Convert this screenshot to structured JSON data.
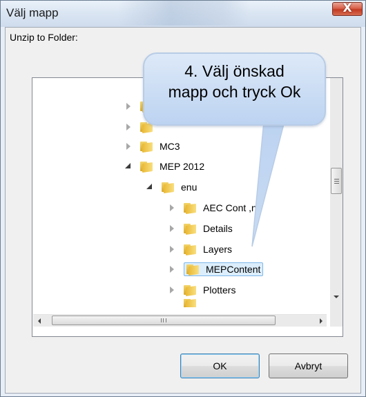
{
  "window": {
    "title": "Välj mapp",
    "close_label": "X"
  },
  "prompt_label": "Unzip to Folder:",
  "tree": {
    "items": [
      {
        "label": "",
        "state": "collapsed",
        "level": 0
      },
      {
        "label": "",
        "state": "collapsed",
        "level": 0
      },
      {
        "label": "MC3",
        "state": "collapsed",
        "level": 0
      },
      {
        "label": "MEP 2012",
        "state": "expanded",
        "level": 0
      },
      {
        "label": "enu",
        "state": "expanded",
        "level": 1
      },
      {
        "label": "AEC Cont ,nt",
        "state": "collapsed",
        "level": 2
      },
      {
        "label": "Details",
        "state": "collapsed",
        "level": 2
      },
      {
        "label": "Layers",
        "state": "collapsed",
        "level": 2
      },
      {
        "label": "MEPContent",
        "state": "collapsed",
        "level": 2,
        "selected": true
      },
      {
        "label": "Plotters",
        "state": "collapsed",
        "level": 2
      },
      {
        "label": "",
        "state": "none",
        "level": 2
      }
    ]
  },
  "scrollbar": {
    "h_grip": "III",
    "v_grip": "≡"
  },
  "buttons": {
    "ok": "OK",
    "cancel": "Avbryt"
  },
  "callout": {
    "line1": "4. Välj önskad",
    "line2": "mapp och tryck Ok"
  },
  "colors": {
    "selection_fill": "#dceefc",
    "selection_border": "#7db6e8",
    "callout_fill": "#bcd3f1",
    "close_button": "#c23b22"
  },
  "icons": {
    "close": "close-icon",
    "folder": "folder-icon",
    "expand_collapsed": "chevron-right-icon",
    "expand_expanded": "chevron-down-icon"
  }
}
